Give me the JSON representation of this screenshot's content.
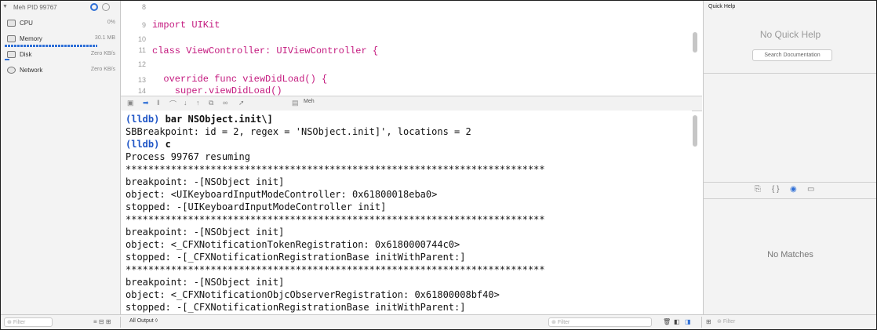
{
  "navigator": {
    "process": "Meh PID 99767",
    "items": [
      {
        "label": "CPU",
        "value": "0%"
      },
      {
        "label": "Memory",
        "value": "30.1 MB"
      },
      {
        "label": "Disk",
        "value": "Zero KB/s"
      },
      {
        "label": "Network",
        "value": "Zero KB/s"
      }
    ],
    "filter_placeholder": "Filter"
  },
  "editor": {
    "lines": [
      {
        "num": "8",
        "code": ""
      },
      {
        "num": "9",
        "code": "import UIKit"
      },
      {
        "num": "10",
        "code": ""
      },
      {
        "num": "11",
        "code": "class ViewController: UIViewController {"
      },
      {
        "num": "12",
        "code": ""
      },
      {
        "num": "13",
        "code": "  override func viewDidLoad() {"
      },
      {
        "num": "14",
        "code": "    super.viewDidLoad()"
      }
    ]
  },
  "debug_bar": {
    "scheme": "Meh"
  },
  "console": {
    "lines": [
      {
        "prompt": "(lldb)",
        "text": " bar NSObject.init\\]"
      },
      {
        "prompt": "",
        "text": "SBBreakpoint: id = 2, regex = 'NSObject.init]', locations = 2"
      },
      {
        "prompt": "(lldb)",
        "text": " c"
      },
      {
        "prompt": "",
        "text": "Process 99767 resuming"
      },
      {
        "prompt": "",
        "text": "**************************************************************************"
      },
      {
        "prompt": "",
        "text": "breakpoint: -[NSObject init]"
      },
      {
        "prompt": "",
        "text": "object: <UIKeyboardInputModeController: 0x61800018eba0>"
      },
      {
        "prompt": "",
        "text": "stopped: -[UIKeyboardInputModeController init]"
      },
      {
        "prompt": "",
        "text": "**************************************************************************"
      },
      {
        "prompt": "",
        "text": "breakpoint: -[NSObject init]"
      },
      {
        "prompt": "",
        "text": "object: <_CFXNotificationTokenRegistration: 0x6180000744c0>"
      },
      {
        "prompt": "",
        "text": "stopped: -[_CFXNotificationRegistrationBase initWithParent:]"
      },
      {
        "prompt": "",
        "text": "**************************************************************************"
      },
      {
        "prompt": "",
        "text": "breakpoint: -[NSObject init]"
      },
      {
        "prompt": "",
        "text": "object: <_CFXNotificationObjcObserverRegistration: 0x61800008bf40>"
      },
      {
        "prompt": "",
        "text": "stopped: -[_CFXNotificationRegistrationBase initWithParent:]"
      }
    ],
    "output_selector": "All Output ◊",
    "filter_placeholder": "Filter"
  },
  "inspector": {
    "title": "Quick Help",
    "no_quick_help": "No Quick Help",
    "search_docs": "Search Documentation",
    "no_matches": "No Matches",
    "filter_placeholder": "Filter"
  },
  "colors": {
    "accent": "#2f6fd6",
    "prompt": "#1f55c6",
    "keyword": "#c41a7f"
  }
}
